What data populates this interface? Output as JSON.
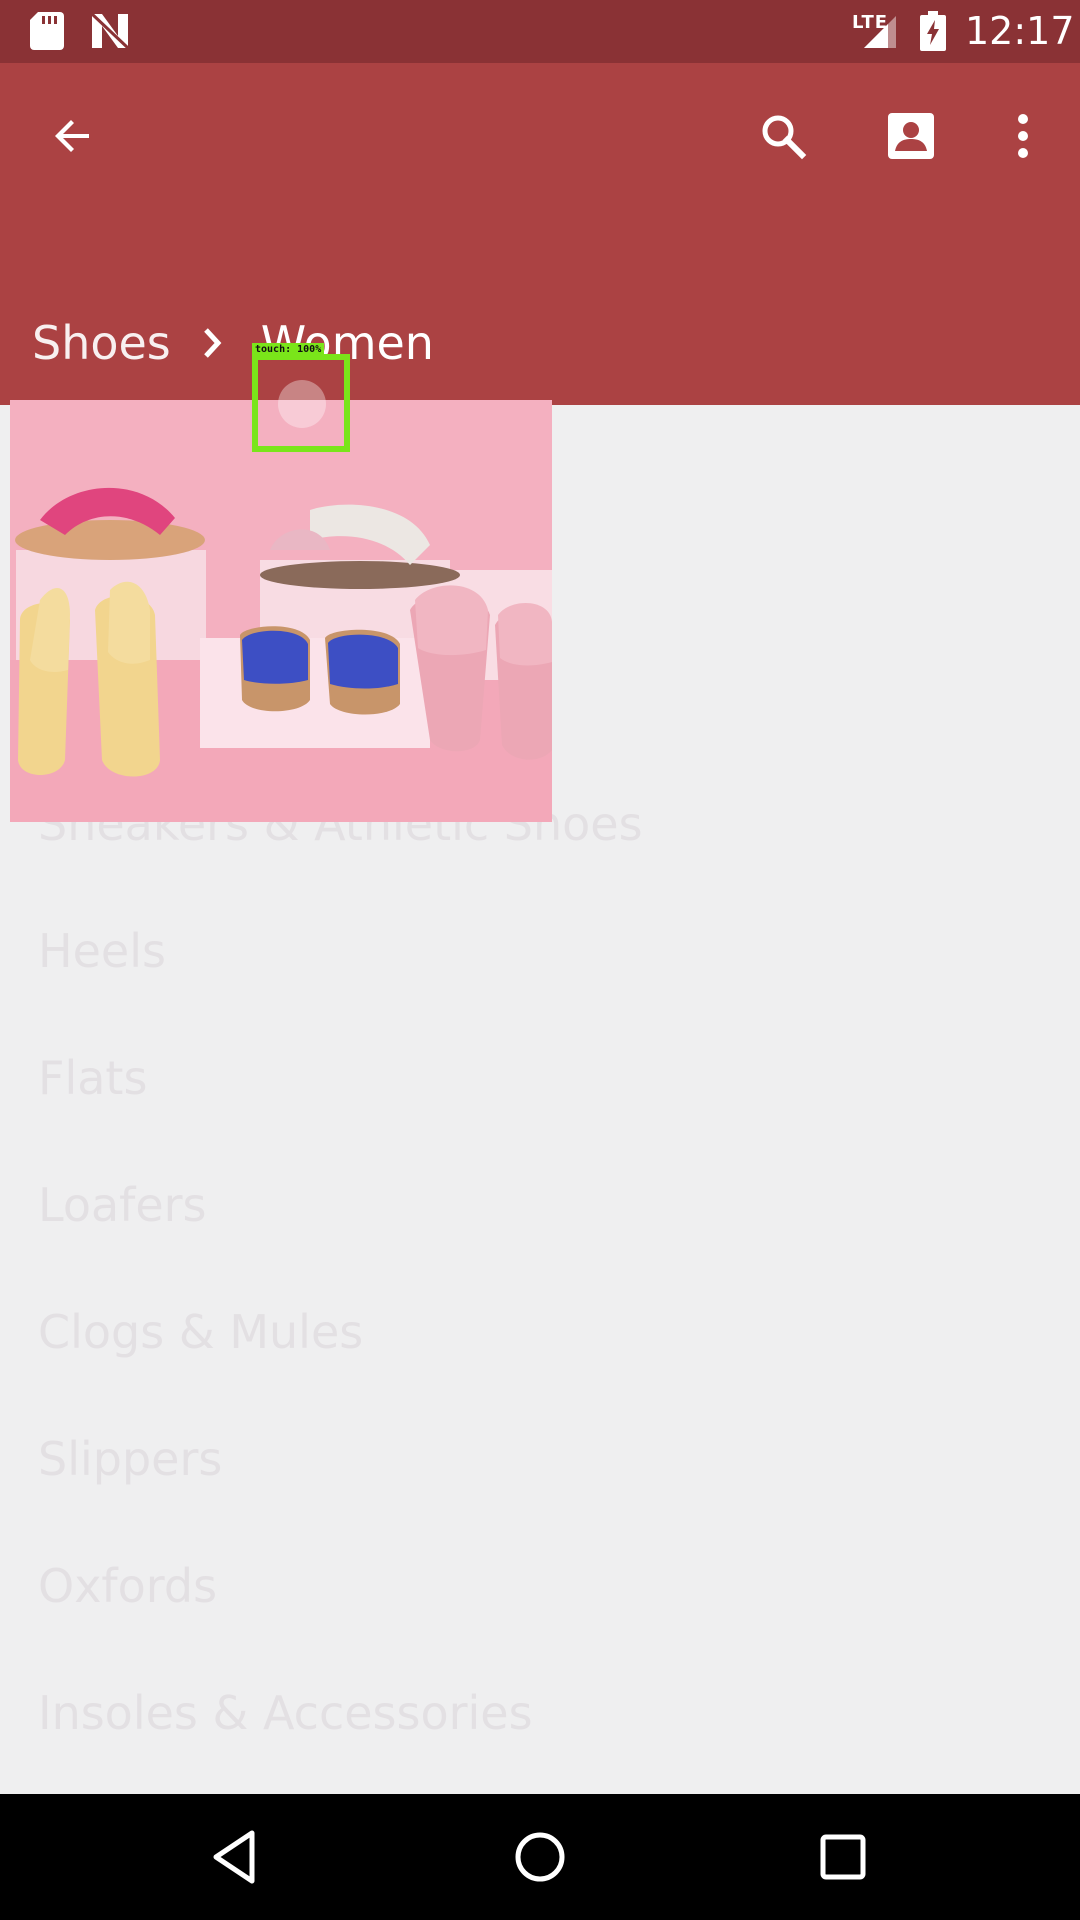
{
  "status_bar": {
    "network_type": "LTE",
    "time": "12:17",
    "icons": [
      "sd-card-icon",
      "n-notification-icon",
      "signal-icon",
      "battery-charging-icon"
    ]
  },
  "app_bar": {
    "icons": [
      "arrow-back-icon",
      "search-icon",
      "account-box-icon",
      "more-vert-icon"
    ],
    "color": "#ab4243"
  },
  "breadcrumb": {
    "parent": "Shoes",
    "current": "Women"
  },
  "touch_overlay": {
    "label": "touch: 100%"
  },
  "categories": [
    {
      "label": "Sneakers & Athletic Shoes"
    },
    {
      "label": "Heels"
    },
    {
      "label": "Flats"
    },
    {
      "label": "Loafers"
    },
    {
      "label": "Clogs & Mules"
    },
    {
      "label": "Slippers"
    },
    {
      "label": "Oxfords"
    },
    {
      "label": "Insoles & Accessories"
    }
  ],
  "nav_bar": {
    "icons": [
      "nav-back-icon",
      "nav-home-icon",
      "nav-recents-icon"
    ]
  }
}
